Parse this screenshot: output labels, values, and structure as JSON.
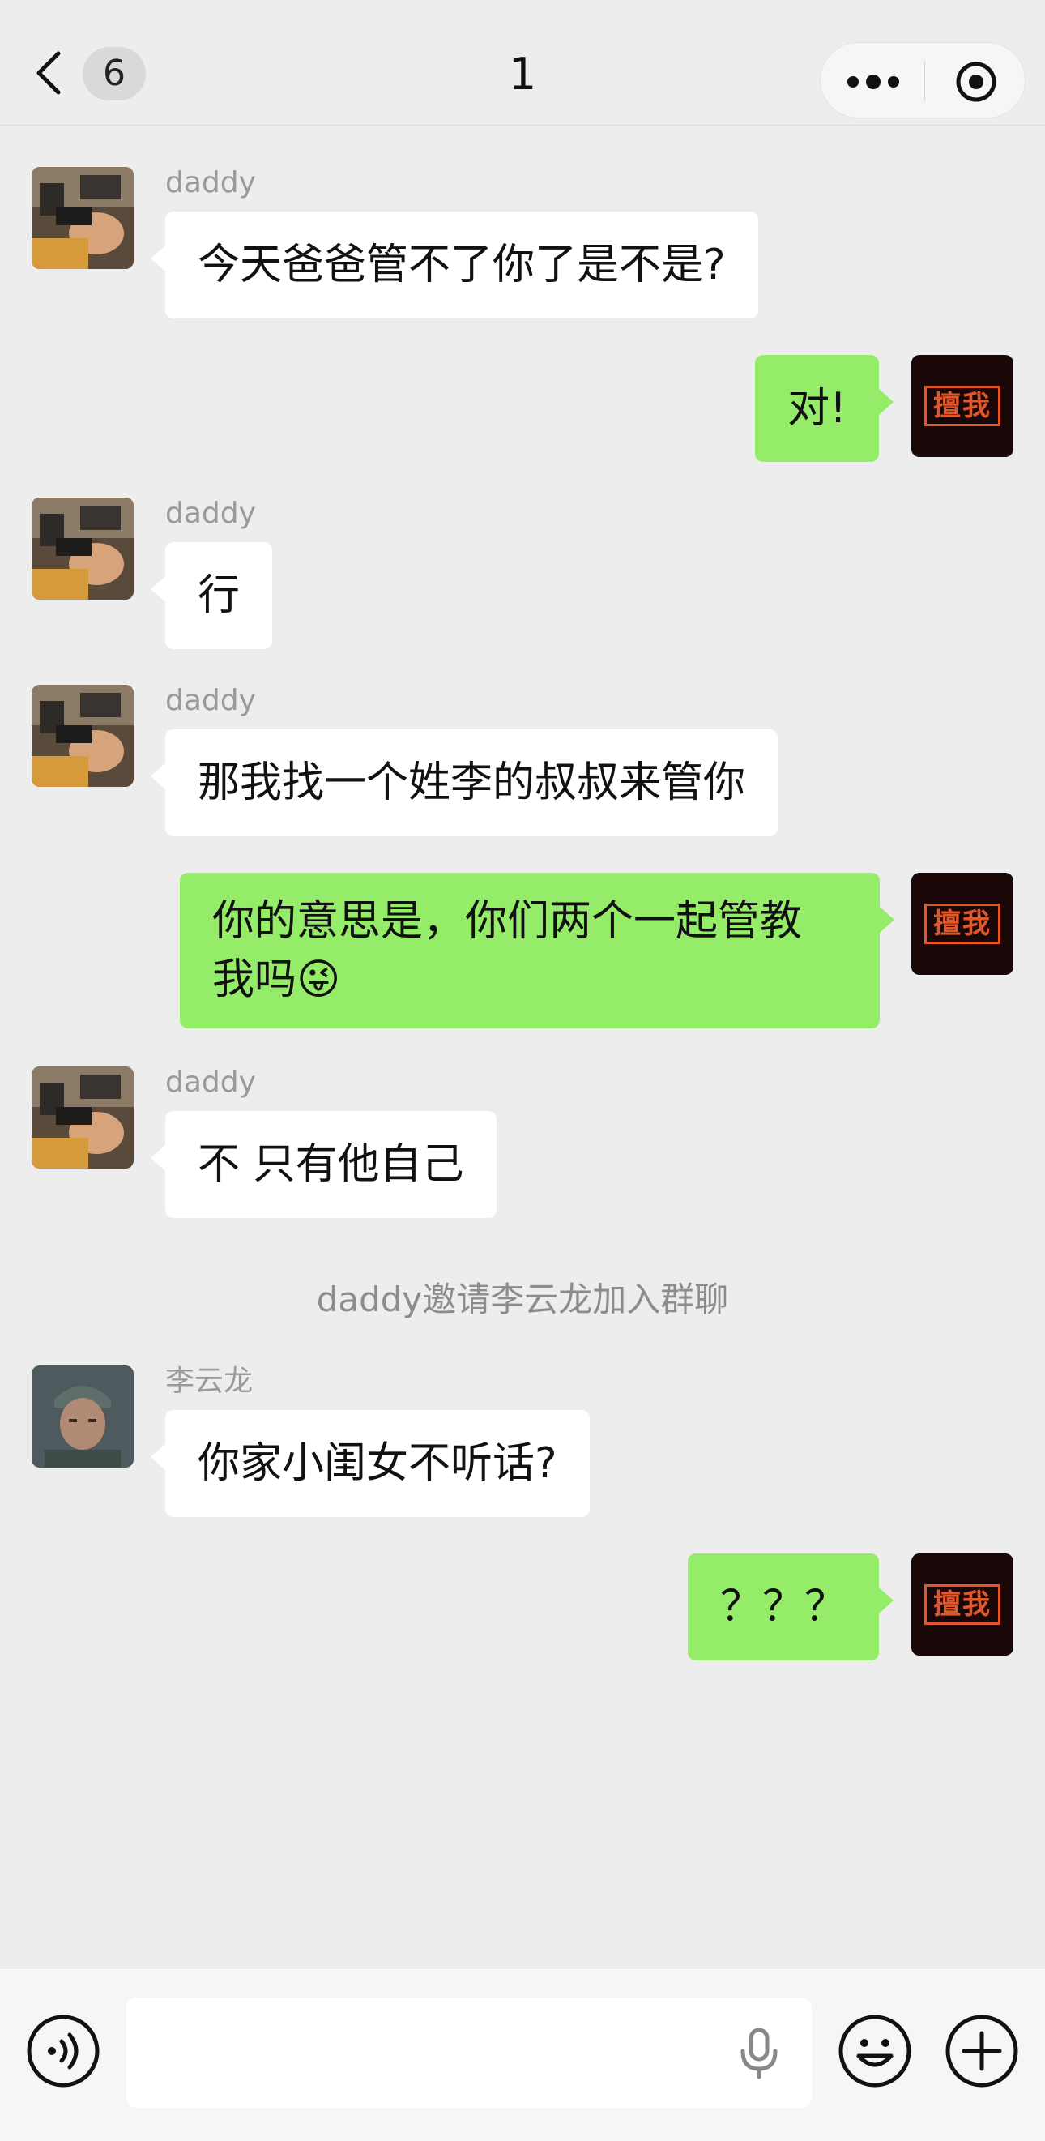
{
  "header": {
    "back_label": "back",
    "unread_count": "6",
    "title": "1"
  },
  "messages": [
    {
      "sender": "daddy",
      "text": "今天爸爸管不了你了是不是?",
      "direction": "incoming"
    },
    {
      "text": "对!",
      "direction": "outgoing"
    },
    {
      "sender": "daddy",
      "text": "行",
      "direction": "incoming"
    },
    {
      "sender": "daddy",
      "text": "那我找一个姓李的叔叔来管你",
      "direction": "incoming"
    },
    {
      "text": "你的意思是，你们两个一起管教我吗😜",
      "line1": "你的意思是，你们两个一起管教",
      "line2": "我吗😜",
      "direction": "outgoing"
    },
    {
      "sender": "daddy",
      "text": "不 只有他自己",
      "direction": "incoming"
    },
    {
      "sender": "李云龙",
      "text": "你家小闺女不听话?",
      "direction": "incoming"
    },
    {
      "text": "？？？",
      "direction": "outgoing"
    }
  ],
  "system_message": "daddy邀请李云龙加入群聊",
  "my_avatar_text": "擅我",
  "input": {
    "value": "",
    "placeholder": ""
  },
  "colors": {
    "background": "#EDEDED",
    "incoming_bubble": "#FFFFFF",
    "outgoing_bubble": "#95EC69",
    "sender_name": "#9A9A9A",
    "my_avatar_bg": "#1A0708",
    "my_avatar_stamp": "#E2572A"
  },
  "icons": [
    "back-arrow-icon",
    "more-dots-icon",
    "close-circle-icon",
    "voice-icon",
    "mic-icon",
    "emoji-icon",
    "plus-icon"
  ]
}
